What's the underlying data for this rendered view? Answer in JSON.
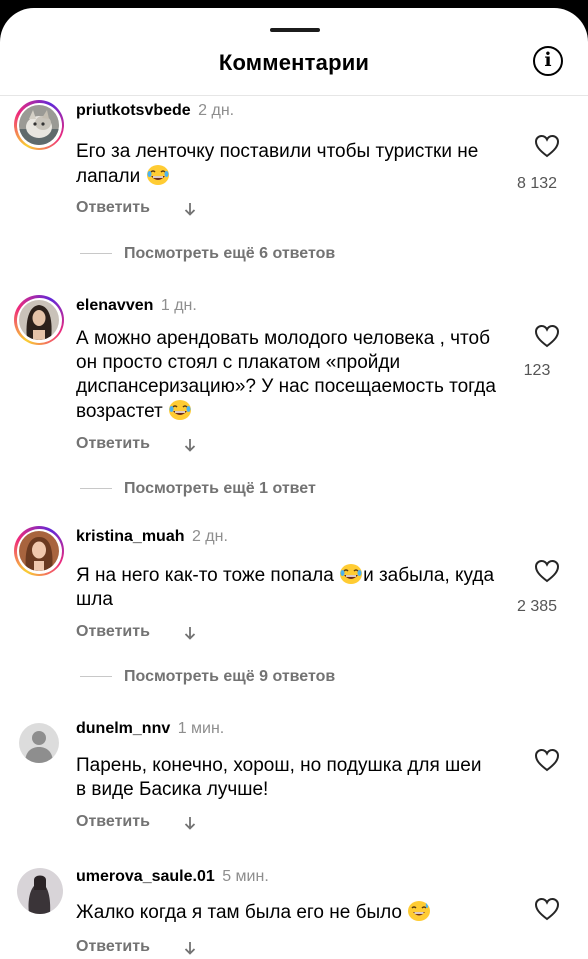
{
  "header": {
    "title": "Комментарии",
    "info_icon": "info-icon"
  },
  "comments": [
    {
      "username": "priutkotsvbede",
      "time": "2 дн.",
      "text": "Его за ленточку поставили чтобы туристки не лапали",
      "emoji": "laughing-face",
      "likes": "8 132",
      "reply_label": "Ответить",
      "more_replies": "Посмотреть ещё 6 ответов"
    },
    {
      "username": "elenavven",
      "time": "1 дн.",
      "text": "А можно арендовать молодого человека , чтоб он просто стоял с плакатом «пройди диспансеризацию»? У нас посещаемость тогда возрастет",
      "emoji": "laughing-face",
      "likes": "123",
      "reply_label": "Ответить",
      "more_replies": "Посмотреть ещё 1 ответ"
    },
    {
      "username": "kristina_muah",
      "time": "2 дн.",
      "text_part1": "Я на него как-то тоже попала",
      "emoji": "laughing-face",
      "text_part2": "и забыла, куда шла",
      "likes": "2 385",
      "reply_label": "Ответить",
      "more_replies": "Посмотреть ещё 9 ответов"
    },
    {
      "username": "dunelm_nnv",
      "time": "1 мин.",
      "text": "Парень, конечно, хорош, но подушка для шеи в виде Басика лучше!",
      "reply_label": "Ответить"
    },
    {
      "username": "umerova_saule.01",
      "time": "5 мин.",
      "text": "Жалко когда я там была его не было",
      "emoji": "sweat-smile-face",
      "reply_label": "Ответить"
    }
  ],
  "colors": {
    "secondary_text": "#737373",
    "story_ring": "#ee2a7b",
    "background": "#ffffff"
  }
}
